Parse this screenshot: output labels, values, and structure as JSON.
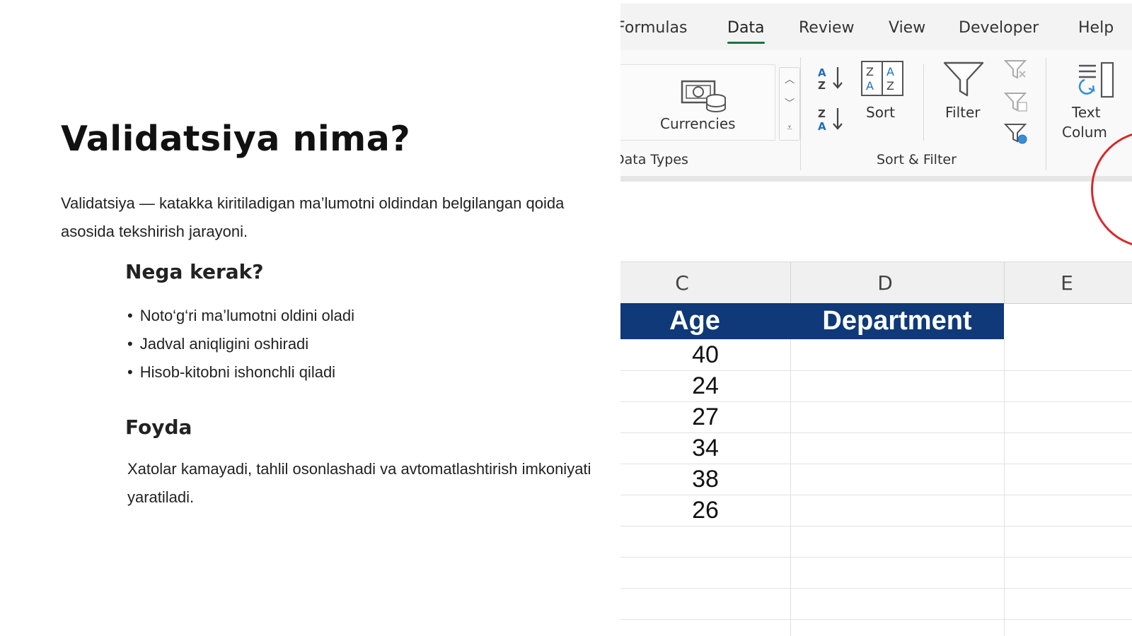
{
  "slide": {
    "title": "Validatsiya nima?",
    "intro": "Validatsiya — katakka kiritiladigan ma’lumotni oldindan belgilangan qoida asosida tekshirish jarayoni.",
    "why_heading": "Nega kerak?",
    "bullets": [
      "Noto‘g‘ri ma’lumotni oldini oladi",
      "Jadval aniqligini oshiradi",
      "Hisob-kitobni ishonchli qiladi"
    ],
    "benefit_heading": "Foyda",
    "benefit_text": "Xatolar kamayadi, tahlil osonlashadi va avtomatlashtirish imkoniyati yaratiladi."
  },
  "excel": {
    "tabs": [
      "Formulas",
      "Data",
      "Review",
      "View",
      "Developer",
      "Help"
    ],
    "active_tab": "Data",
    "accent_color": "#1e7145",
    "ribbon": {
      "currencies_label": "Currencies",
      "data_types_group": "Data Types",
      "sort_label": "Sort",
      "filter_label": "Filter",
      "sort_filter_group": "Sort & Filter",
      "text_to_columns_line1": "Text",
      "text_to_columns_line2": "Colum",
      "left_fragment": ":"
    },
    "columns": [
      "C",
      "D",
      "E"
    ],
    "header_fill": "#0f3978",
    "headers": {
      "age": "Age",
      "department": "Department"
    },
    "ages": [
      "40",
      "24",
      "27",
      "34",
      "38",
      "26"
    ]
  }
}
